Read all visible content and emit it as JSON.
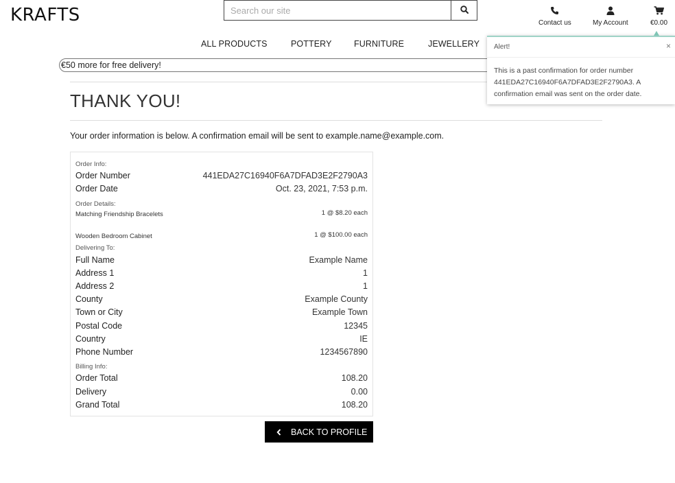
{
  "header": {
    "logo": "KRAFTS",
    "search_placeholder": "Search our site",
    "contact_label": "Contact us",
    "account_label": "My Account",
    "cart_total": "€0.00"
  },
  "nav": [
    "ALL PRODUCTS",
    "POTTERY",
    "FURNITURE",
    "JEWELLERY"
  ],
  "promo": "€50 more for free delivery!",
  "page": {
    "title": "THANK YOU!",
    "intro": "Your order information is below. A confirmation email will be sent to example.name@example.com."
  },
  "order": {
    "info_heading": "Order Info:",
    "number_label": "Order Number",
    "number": "441EDA27C16940F6A7DFAD3E2F2790A3",
    "date_label": "Order Date",
    "date": "Oct. 23, 2021, 7:53 p.m.",
    "details_heading": "Order Details:",
    "items": [
      {
        "name": "Matching Friendship Bracelets",
        "qty": "1 @ $8.20 each"
      },
      {
        "name": "Wooden Bedroom Cabinet",
        "qty": "1 @ $100.00 each"
      }
    ],
    "delivery_heading": "Delivering To:",
    "delivery": [
      {
        "label": "Full Name",
        "value": "Example Name"
      },
      {
        "label": "Address 1",
        "value": "1"
      },
      {
        "label": "Address 2",
        "value": "1"
      },
      {
        "label": "County",
        "value": "Example County"
      },
      {
        "label": "Town or City",
        "value": "Example Town"
      },
      {
        "label": "Postal Code",
        "value": "12345"
      },
      {
        "label": "Country",
        "value": "IE"
      },
      {
        "label": "Phone Number",
        "value": "1234567890"
      }
    ],
    "billing_heading": "Billing Info:",
    "billing": [
      {
        "label": "Order Total",
        "value": "108.20"
      },
      {
        "label": "Delivery",
        "value": "0.00"
      },
      {
        "label": "Grand Total",
        "value": "108.20"
      }
    ]
  },
  "back_button": "BACK TO PROFILE",
  "alert": {
    "title": "Alert!",
    "close": "×",
    "message": "This is a past confirmation for order number 441EDA27C16940F6A7DFAD3E2F2790A3. A confirmation email was sent on the order date."
  },
  "icons": {
    "search": "search-icon",
    "phone": "phone-icon",
    "account": "user-icon",
    "cart": "cart-icon",
    "back": "chevron-left-icon"
  },
  "colors": {
    "alert_accent": "#9fd3c7",
    "button_bg": "#000000"
  }
}
